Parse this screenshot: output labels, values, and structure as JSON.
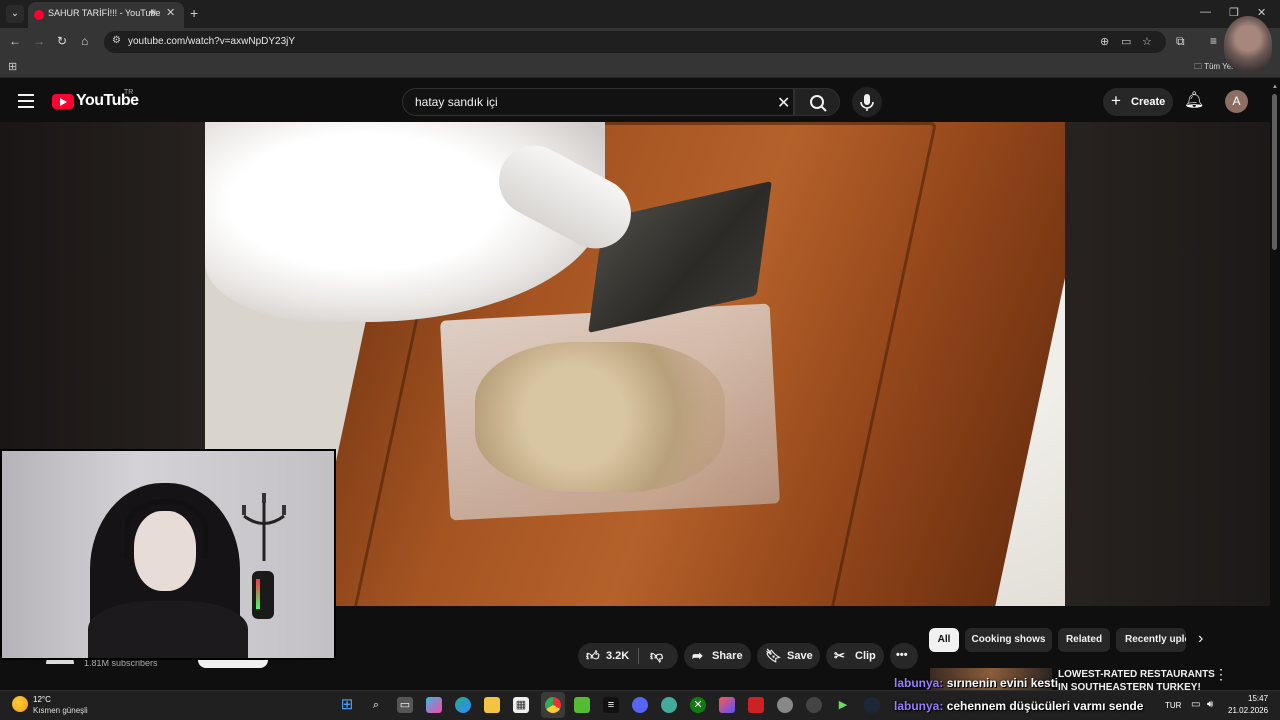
{
  "browser": {
    "tab_title": "SAHUR TARİFİ!!! - YouTube",
    "url": "youtube.com/watch?v=axwNpDY23jY",
    "bookmark_all": "Tüm Yer İm..."
  },
  "youtube": {
    "logo": "YouTube",
    "country": "TR",
    "search_query": "hatay sandık içi",
    "create_label": "Create",
    "avatar_letter": "A",
    "subscribers": "1.81M subscribers",
    "like_count": "3.2K",
    "share_label": "Share",
    "save_label": "Save",
    "clip_label": "Clip",
    "more_label": "•••",
    "chips": [
      "All",
      "Cooking shows",
      "Related",
      "Recently uploaded"
    ],
    "recommendation": {
      "title": "LOWEST-RATED RESTAURANTS IN SOUTHEASTERN TURKEY!"
    }
  },
  "chat": [
    {
      "user": "labunya:",
      "message": "sırınenin evini kesti"
    },
    {
      "user": "labunya:",
      "message": "cehennem düşücüleri varmı sende"
    }
  ],
  "taskbar": {
    "temperature": "12°C",
    "weather": "Kısmen güneşli",
    "language": "TUR",
    "time": "15:47",
    "date": "21.02.2026"
  },
  "colors": {
    "youtube_red": "#ff0033",
    "chat_username": "#9b7bff",
    "background": "#0f0f0f"
  }
}
